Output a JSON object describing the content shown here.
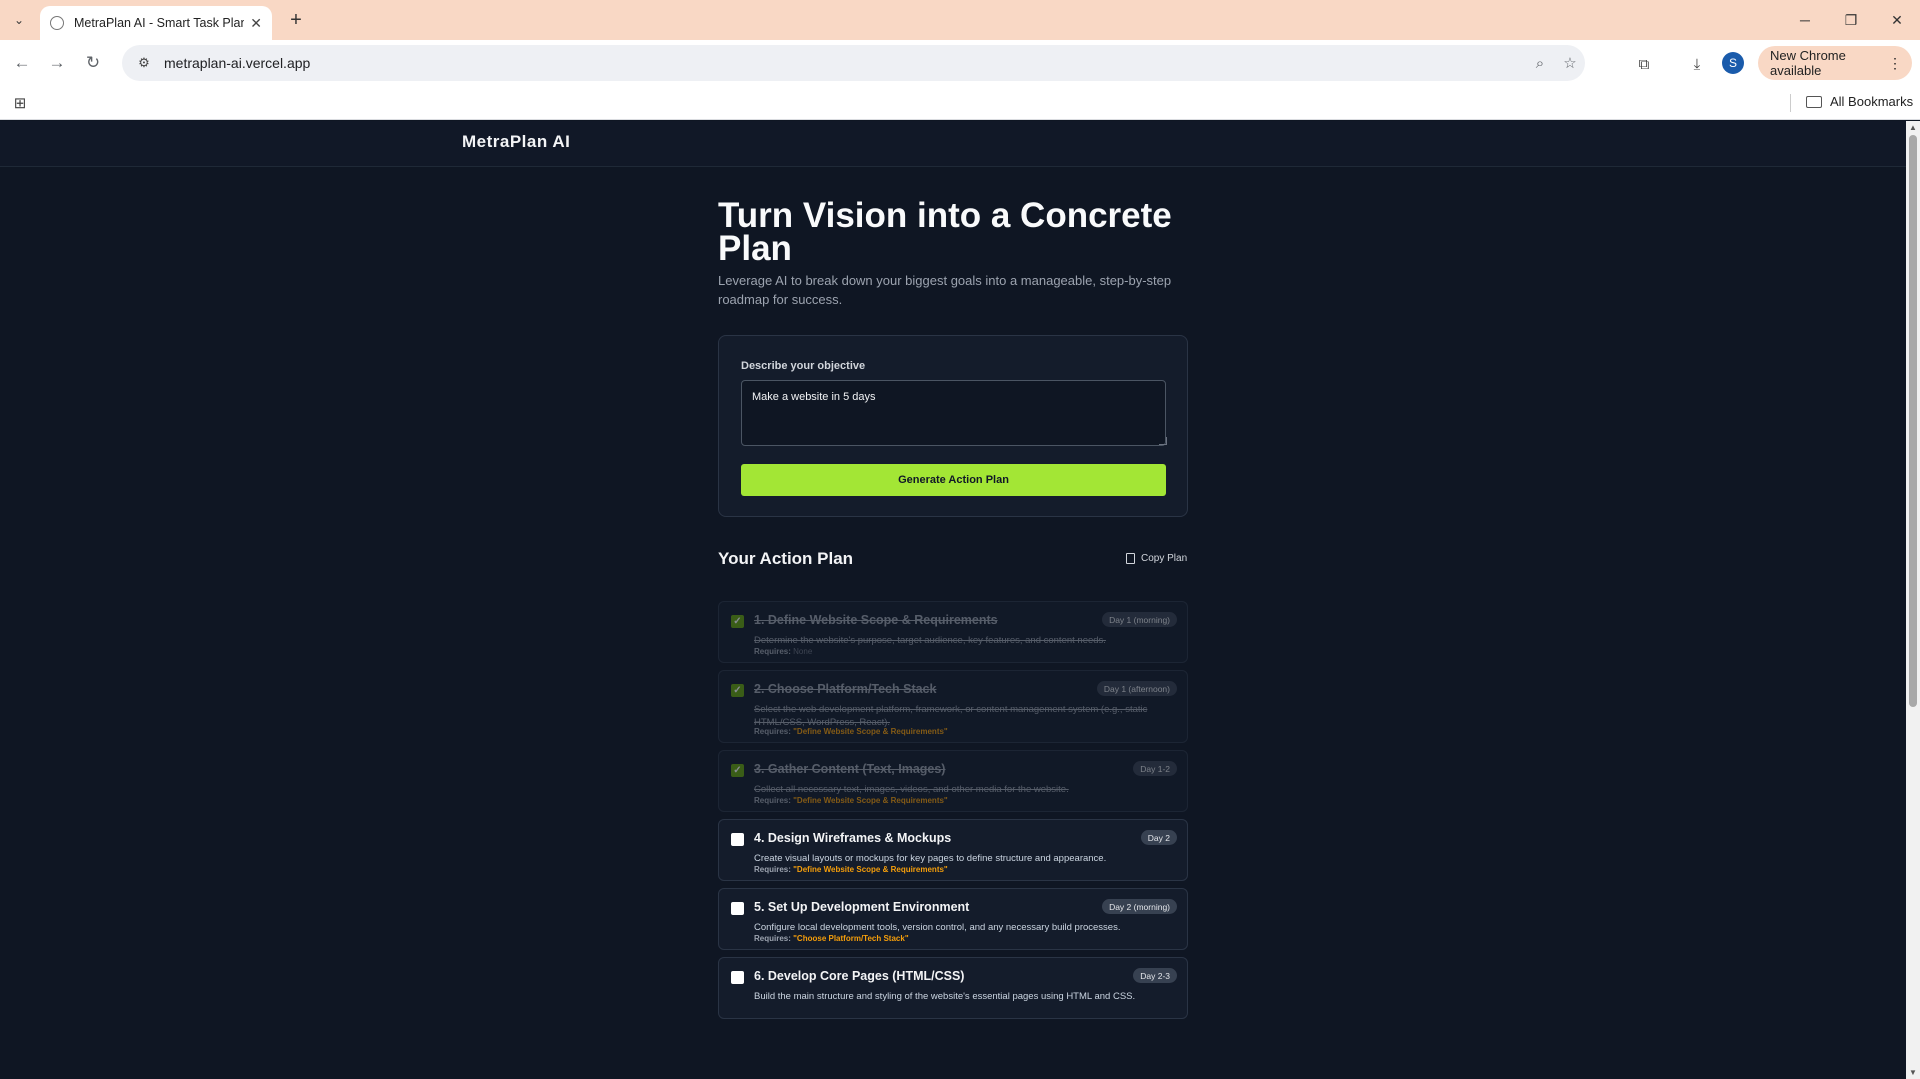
{
  "browser": {
    "tab_title": "MetraPlan AI - Smart Task Planner",
    "url": "metraplan-ai.vercel.app",
    "profile_initial": "S",
    "update_label": "New Chrome available",
    "all_bookmarks": "All Bookmarks"
  },
  "app": {
    "brand": "MetraPlan AI",
    "hero_title": "Turn Vision into a Concrete Plan",
    "hero_subtitle": "Leverage AI to break down your biggest goals into a manageable, step-by-step roadmap for success.",
    "objective_label": "Describe your objective",
    "objective_value": "Make a website in 5 days",
    "generate_label": "Generate Action Plan",
    "plan_title": "Your Action Plan",
    "copy_label": "Copy Plan",
    "requires_label": "Requires:"
  },
  "tasks": [
    {
      "title": "1. Define Website Scope & Requirements",
      "badge": "Day 1 (morning)",
      "desc": "Determine the website's purpose, target audience, key features, and content needs.",
      "requires": "None",
      "done": true
    },
    {
      "title": "2. Choose Platform/Tech Stack",
      "badge": "Day 1 (afternoon)",
      "desc": "Select the web development platform, framework, or content management system (e.g., static HTML/CSS, WordPress, React).",
      "requires": "\"Define Website Scope & Requirements\"",
      "done": true
    },
    {
      "title": "3. Gather Content (Text, Images)",
      "badge": "Day 1-2",
      "desc": "Collect all necessary text, images, videos, and other media for the website.",
      "requires": "\"Define Website Scope & Requirements\"",
      "done": true
    },
    {
      "title": "4. Design Wireframes & Mockups",
      "badge": "Day 2",
      "desc": "Create visual layouts or mockups for key pages to define structure and appearance.",
      "requires": "\"Define Website Scope & Requirements\"",
      "done": false
    },
    {
      "title": "5. Set Up Development Environment",
      "badge": "Day 2 (morning)",
      "desc": "Configure local development tools, version control, and any necessary build processes.",
      "requires": "\"Choose Platform/Tech Stack\"",
      "done": false
    },
    {
      "title": "6. Develop Core Pages (HTML/CSS)",
      "badge": "Day 2-3",
      "desc": "Build the main structure and styling of the website's essential pages using HTML and CSS.",
      "requires": "",
      "done": false
    }
  ],
  "colors": {
    "accent": "#a3e635",
    "background": "#0f1623",
    "card": "#141c2b",
    "requires_value": "#f59e0b"
  }
}
